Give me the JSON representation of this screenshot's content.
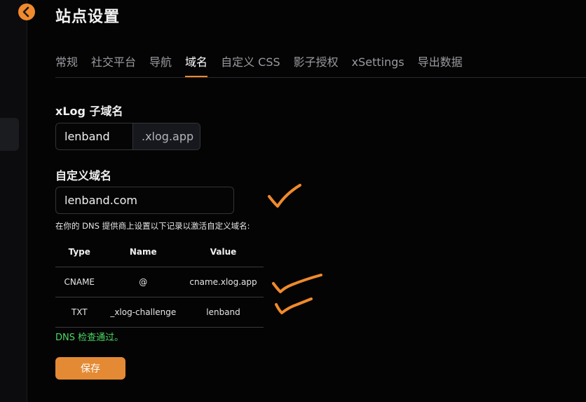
{
  "page": {
    "title": "站点设置"
  },
  "tabs": [
    {
      "label": "常规"
    },
    {
      "label": "社交平台"
    },
    {
      "label": "导航"
    },
    {
      "label": "域名",
      "active": true
    },
    {
      "label": "自定义 CSS"
    },
    {
      "label": "影子授权"
    },
    {
      "label": "xSettings"
    },
    {
      "label": "导出数据"
    }
  ],
  "subdomain": {
    "label": "xLog 子域名",
    "value": "lenband",
    "suffix": ".xlog.app"
  },
  "custom_domain": {
    "label": "自定义域名",
    "value": "lenband.com",
    "hint": "在你的 DNS 提供商上设置以下记录以激活自定义域名:"
  },
  "dns_table": {
    "headers": [
      "Type",
      "Name",
      "Value"
    ],
    "rows": [
      [
        "CNAME",
        "@",
        "cname.xlog.app"
      ],
      [
        "TXT",
        "_xlog-challenge",
        "lenband"
      ]
    ]
  },
  "status": {
    "text": "DNS 检查通过。"
  },
  "actions": {
    "save_label": "保存"
  },
  "colors": {
    "accent": "#f08a2c",
    "success": "#4cd964",
    "background": "#040404",
    "annotation": "#f08a2c"
  },
  "icons": {
    "back": "chevron-left-icon",
    "annotation": "checkmark-annotation-icon"
  }
}
